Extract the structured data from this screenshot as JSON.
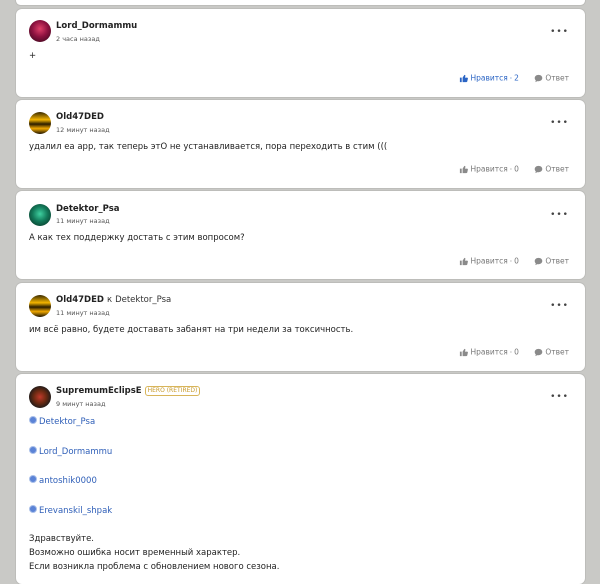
{
  "comments": [
    {
      "author": "Lord_Dormammu",
      "time": "2 часа назад",
      "text": "+",
      "like_label": "Нравится",
      "likes": "2",
      "reply_label": "Ответ"
    },
    {
      "author": "Old47DED",
      "time": "12 минут назад",
      "text": "удалил ea app, так теперь этО не устанавливается, пора переходить в стим (((",
      "like_label": "Нравится",
      "likes": "0",
      "reply_label": "Ответ"
    },
    {
      "author": "Detektor_Psa",
      "time": "11 минут назад",
      "text": "А как тех поддержку достать с этим вопросом?",
      "like_label": "Нравится",
      "likes": "0",
      "reply_label": "Ответ"
    },
    {
      "author": "Old47DED",
      "reply_to_prefix": "к",
      "reply_to": "Detektor_Psa",
      "time": "11 минут назад",
      "text": "им всё равно, будете доставать забанят на три недели за токсичность.",
      "like_label": "Нравится",
      "likes": "0",
      "reply_label": "Ответ"
    },
    {
      "author": "SupremumEclipsE",
      "badge": "HERO (RETIRED)",
      "time": "9 минут назад",
      "mentions": [
        "Detektor_Psa",
        "Lord_Dormammu",
        "antoshik0000",
        "Erevanskil_shpak"
      ],
      "lines": [
        "Здравствуйте.",
        "Возможно ошибка носит временный характер.",
        "Если возникла проблема с обновлением нового сезона."
      ]
    }
  ],
  "colors": {
    "background": "#c9c9c6",
    "card": "#ffffff",
    "link": "#2f5fb8",
    "like_active": "#2a64c4",
    "badge": "#c89a2a"
  },
  "icons": {
    "more": "more-dots-icon",
    "like": "thumb-up-icon",
    "reply": "speech-bubble-icon",
    "mention": "mention-dot-icon"
  }
}
